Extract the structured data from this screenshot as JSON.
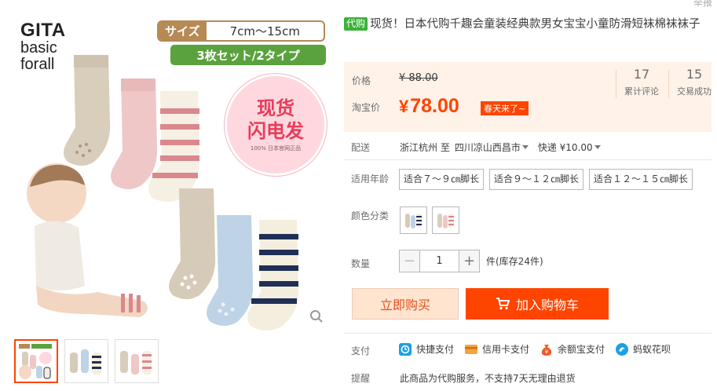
{
  "corner": {
    "text": "举报"
  },
  "gallery": {
    "brand_line1": "GITA",
    "brand_line2": "basic",
    "brand_line3": "forall",
    "size_key": "サイズ",
    "size_value": "7cm〜15cm",
    "set_text": "3枚セット/2タイプ",
    "stock_line1": "现货",
    "stock_line2": "闪电发",
    "stock_line3": "100% 日本官网正品",
    "zoom_icon": "magnifier-icon",
    "thumb_count": 3
  },
  "product": {
    "tag": "代购",
    "title": "现货！日本代购千趣会童装经典款男女宝宝小童防滑短袜棉袜袜子"
  },
  "price": {
    "orig_label": "价格",
    "orig_value": "¥ 88.00",
    "promo_label": "淘宝价",
    "promo_currency": "¥",
    "promo_value": "78.00",
    "promo_tag": "春天来了~",
    "reviews_count": "17",
    "reviews_label": "累计评论",
    "sales_count": "15",
    "sales_label": "交易成功"
  },
  "shipping": {
    "label": "配送",
    "from": "浙江杭州 至",
    "to": "四川凉山西昌市",
    "method": "快递 ¥10.00"
  },
  "age": {
    "label": "适用年龄",
    "options": [
      "适合７～９㎝脚长",
      "适合９～１２㎝脚长",
      "适合１２～１５㎝脚长"
    ]
  },
  "color": {
    "label": "颜色分类"
  },
  "quantity": {
    "label": "数量",
    "value": "1",
    "stock": "件(库存24件)",
    "minus": "−",
    "plus": "+"
  },
  "actions": {
    "buy": "立即购买",
    "cart": "加入购物车"
  },
  "payment": {
    "label": "支付",
    "methods": [
      "快捷支付",
      "信用卡支付",
      "余额宝支付",
      "蚂蚁花呗"
    ]
  },
  "notice": {
    "label": "提醒",
    "text": "此商品为代购服务，不支持7天无理由退货"
  },
  "colors": {
    "accent": "#ff4400",
    "price_bg": "#fff2e8",
    "tag_green": "#3bb13b"
  }
}
